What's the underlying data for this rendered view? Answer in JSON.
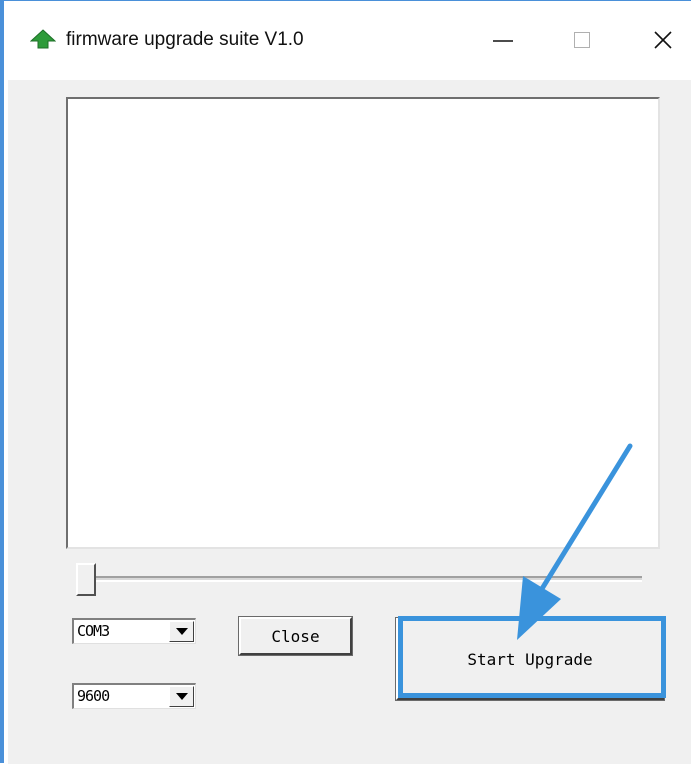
{
  "window": {
    "title": "firmware upgrade suite V1.0",
    "icon": "green-up-arrow-icon"
  },
  "captions": {
    "minimize_icon": "minimize-icon",
    "maximize_icon": "maximize-icon",
    "close_icon": "close-icon"
  },
  "log": {
    "text": ""
  },
  "progress": {
    "value": 0
  },
  "serial": {
    "port": "COM3",
    "baud": "9600"
  },
  "buttons": {
    "close_label": "Close",
    "start_label": "Start Upgrade"
  },
  "annotation": {
    "color": "#3a93dc",
    "icon": "pointer-arrow-icon"
  }
}
